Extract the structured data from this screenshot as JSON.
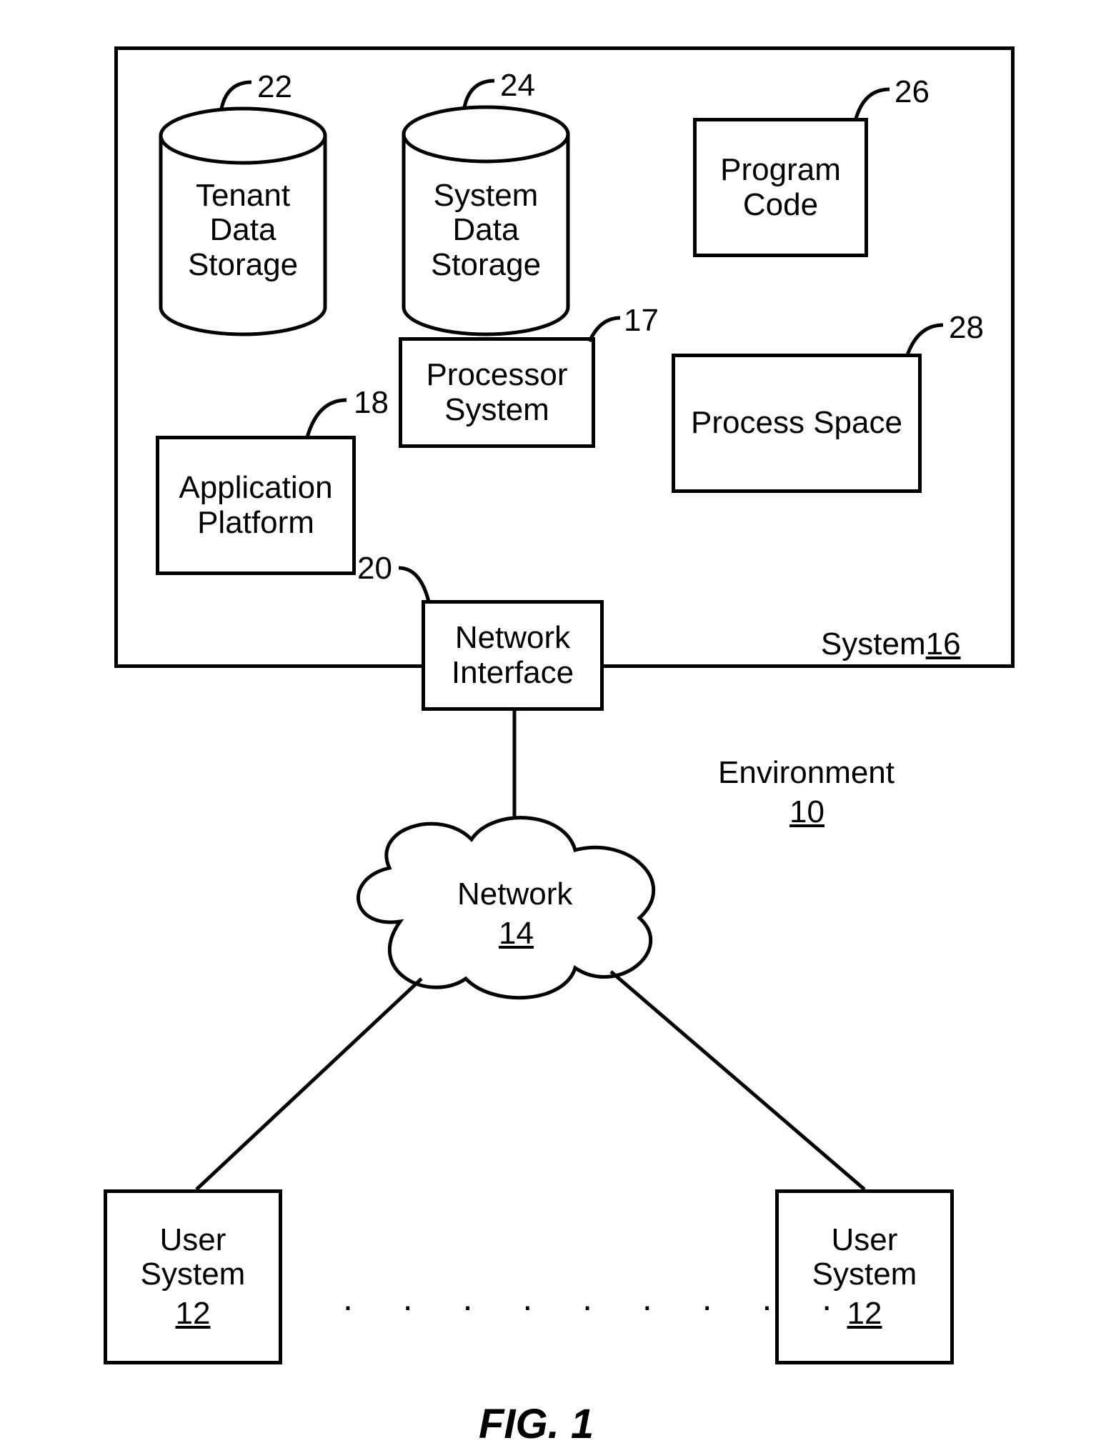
{
  "boxes": {
    "tenant_data_storage": {
      "label": "Tenant\nData\nStorage",
      "ref": "22"
    },
    "system_data_storage": {
      "label": "System\nData\nStorage",
      "ref": "24"
    },
    "program_code": {
      "label": "Program\nCode",
      "ref": "26"
    },
    "processor_system": {
      "label": "Processor\nSystem",
      "ref": "17"
    },
    "process_space": {
      "label": "Process Space",
      "ref": "28"
    },
    "application_platform": {
      "label": "Application\nPlatform",
      "ref": "18"
    },
    "network_interface": {
      "label": "Network\nInterface",
      "ref": "20"
    },
    "system_container": {
      "label": "System",
      "ref": "16"
    },
    "network": {
      "label": "Network",
      "ref": "14"
    },
    "environment": {
      "label": "Environment",
      "ref": "10"
    },
    "user_system_left": {
      "label": "User\nSystem",
      "ref": "12"
    },
    "user_system_right": {
      "label": "User\nSystem",
      "ref": "12"
    }
  },
  "caption": "FIG. 1",
  "ellipsis_dots": 9
}
